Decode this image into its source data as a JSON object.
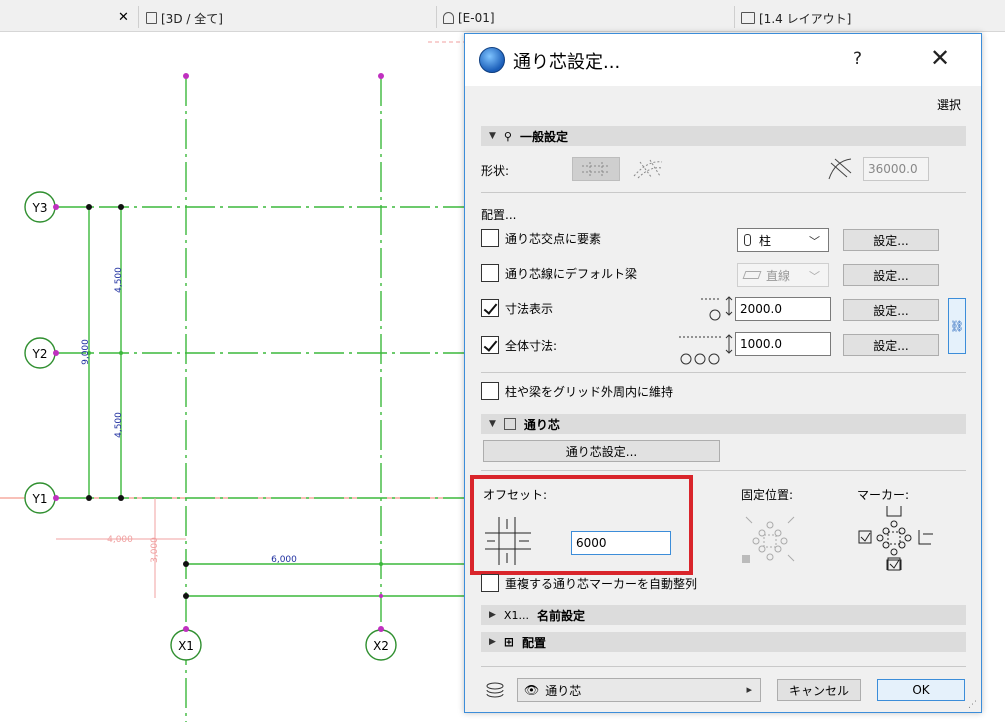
{
  "tabs": [
    {
      "label": "[3D / 全て]"
    },
    {
      "label": "[E-01]"
    },
    {
      "label": "[1.4 レイアウト]"
    }
  ],
  "drawing": {
    "grid_labels": [
      "Y3",
      "Y2",
      "Y1",
      "X1",
      "X2"
    ],
    "dims": [
      "4,500",
      "9,000",
      "4,500",
      "4,000",
      "3,000",
      "6,000"
    ]
  },
  "dialog": {
    "title": "通り芯設定...",
    "help": "?",
    "select_label": "選択",
    "general_section": "一般設定",
    "shape_label": "形状:",
    "length_value": "36000.0",
    "placement_label": "配置...",
    "elem_at_intersection": "通り芯交点に要素",
    "column_option": "柱",
    "default_beam": "通り芯線にデフォルト梁",
    "beam_option": "直線",
    "settings_label": "設定...",
    "dimension_display": "寸法表示",
    "dimension_value": "2000.0",
    "total_dimension": "全体寸法:",
    "total_value": "1000.0",
    "keep_inside": "柱や梁をグリッド外周内に維持",
    "grid_section": "通り芯",
    "grid_settings_btn": "通り芯設定...",
    "offset_label": "オフセット:",
    "offset_value": "6000",
    "fixed_pos_label": "固定位置:",
    "marker_label": "マーカー:",
    "auto_align": "重複する通り芯マーカーを自動整列",
    "name_section_prefix": "X1...",
    "name_section": "名前設定",
    "layout_section": "配置",
    "layer_value": "通り芯",
    "cancel": "キャンセル",
    "ok": "OK"
  },
  "colors": {
    "grid_green": "#3cb83c",
    "grid_dash": "#6ab06a",
    "dim_blue": "#2030a0",
    "dim_pink": "#f0a0a0",
    "highlight_red": "#d9252b",
    "accent_blue": "#3c8dd9"
  }
}
